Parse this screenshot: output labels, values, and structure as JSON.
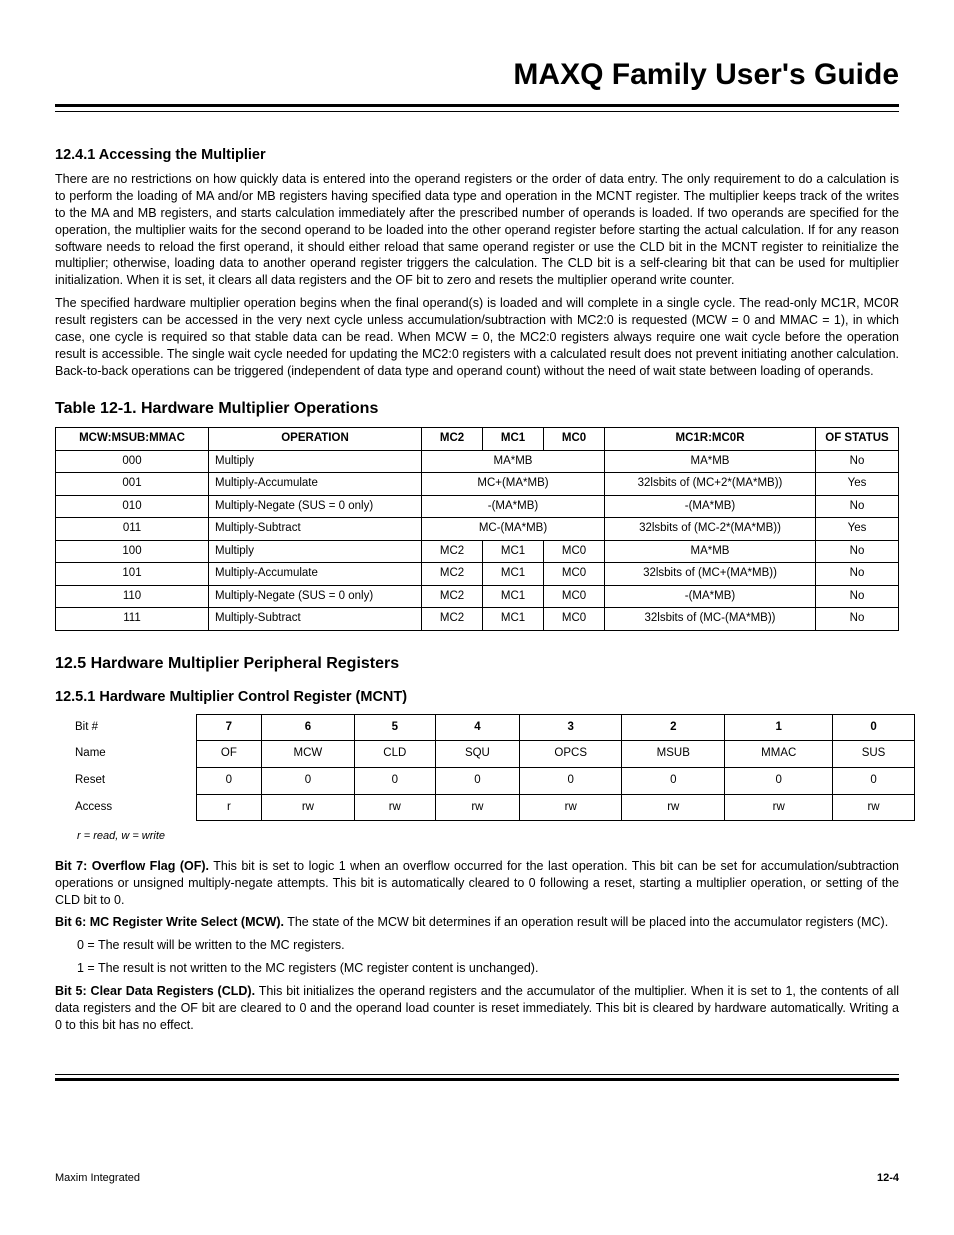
{
  "header": {
    "title": "MAXQ Family User's Guide"
  },
  "sections": {
    "s1241_h": "12.4.1 Accessing the Multiplier",
    "s1241_p1": "There are no restrictions on how quickly data is entered into the operand registers or the order of data entry. The only requirement to do a calculation is to perform the loading of MA and/or MB registers having specified data type and operation in the MCNT register. The multiplier keeps track of the writes to the MA and MB registers, and starts calculation immediately after the prescribed number of operands is loaded. If two operands are specified for the operation, the multiplier waits for the second operand to be loaded into the other operand register before starting the actual calculation. If for any reason software needs to reload the first operand, it should either reload that same operand register or use the CLD bit in the MCNT register to reinitialize the multiplier; otherwise, loading data to another operand register triggers the calculation. The CLD bit is a self-clearing bit that can be used for multiplier initialization. When it is set, it clears all data registers and the OF bit to zero and resets the multiplier operand write counter.",
    "s1241_p2": "The specified hardware multiplier operation begins when the final operand(s) is loaded and will complete in a single cycle. The read-only MC1R, MC0R result registers can be accessed in the very next cycle unless accumulation/subtraction with MC2:0 is requested (MCW = 0 and MMAC = 1), in which case, one cycle is required so that stable data can be read. When MCW = 0, the MC2:0 registers always require one wait cycle before the operation result is accessible. The single wait cycle needed for updating the MC2:0 registers with a calculated result does not prevent initiating another calculation. Back-to-back operations can be triggered (independent of data type and operand count) without the need of wait state between loading of operands.",
    "t121_cap": "Table 12-1. Hardware Multiplier Operations",
    "s125_h": "12.5 Hardware Multiplier Peripheral Registers",
    "s1251_h": "12.5.1 Hardware Multiplier Control Register (MCNT)",
    "rwnote": "r = read, w = write",
    "bit7_l": "Bit 7: Overflow Flag (OF).",
    "bit7_t": " This bit is set to logic 1 when an overflow occurred for the last operation. This bit can be set for accumulation/subtraction operations or unsigned multiply-negate attempts. This bit is automatically cleared to 0 following a reset, starting a multiplier operation, or setting of the CLD bit to 0.",
    "bit6_l": "Bit 6: MC Register Write Select (MCW).",
    "bit6_t": " The state of the MCW bit determines if an operation result will be placed into the accumulator registers (MC).",
    "bit6_0": "0 = The result will be written to the MC registers.",
    "bit6_1": "1 = The result is not written to the MC registers (MC register content is unchanged).",
    "bit5_l": "Bit 5: Clear Data Registers (CLD).",
    "bit5_t": " This bit initializes the operand registers and the accumulator of the multiplier. When it is set to 1, the contents of all data registers and the OF bit are cleared to 0 and the operand load counter is reset immediately. This bit is cleared by hardware automatically. Writing a 0 to this bit has no effect."
  },
  "table121": {
    "headers": [
      "MCW:MSUB:MMAC",
      "OPERATION",
      "MC2",
      "MC1",
      "MC0",
      "MC1R:MC0R",
      "OF STATUS"
    ],
    "rows": [
      {
        "code": "000",
        "op": "Multiply",
        "merged": true,
        "merged_text": "MA*MB",
        "mc1r": "MA*MB",
        "of": "No"
      },
      {
        "code": "001",
        "op": "Multiply-Accumulate",
        "merged": true,
        "merged_text": "MC+(MA*MB)",
        "mc1r": "32lsbits of (MC+2*(MA*MB))",
        "of": "Yes"
      },
      {
        "code": "010",
        "op": "Multiply-Negate (SUS = 0 only)",
        "merged": true,
        "merged_text": "-(MA*MB)",
        "mc1r": "-(MA*MB)",
        "of": "No"
      },
      {
        "code": "011",
        "op": "Multiply-Subtract",
        "merged": true,
        "merged_text": "MC-(MA*MB)",
        "mc1r": "32lsbits of (MC-2*(MA*MB))",
        "of": "Yes"
      },
      {
        "code": "100",
        "op": "Multiply",
        "mc2": "MC2",
        "mc1": "MC1",
        "mc0": "MC0",
        "mc1r": "MA*MB",
        "of": "No"
      },
      {
        "code": "101",
        "op": "Multiply-Accumulate",
        "mc2": "MC2",
        "mc1": "MC1",
        "mc0": "MC0",
        "mc1r": "32lsbits of (MC+(MA*MB))",
        "of": "No"
      },
      {
        "code": "110",
        "op": "Multiply-Negate (SUS = 0 only)",
        "mc2": "MC2",
        "mc1": "MC1",
        "mc0": "MC0",
        "mc1r": "-(MA*MB)",
        "of": "No"
      },
      {
        "code": "111",
        "op": "Multiply-Subtract",
        "mc2": "MC2",
        "mc1": "MC1",
        "mc0": "MC0",
        "mc1r": "32lsbits of (MC-(MA*MB))",
        "of": "No"
      }
    ]
  },
  "regtable": {
    "rowlabels": [
      "Bit #",
      "Name",
      "Reset",
      "Access"
    ],
    "bits": [
      "7",
      "6",
      "5",
      "4",
      "3",
      "2",
      "1",
      "0"
    ],
    "names": [
      "OF",
      "MCW",
      "CLD",
      "SQU",
      "OPCS",
      "MSUB",
      "MMAC",
      "SUS"
    ],
    "resets": [
      "0",
      "0",
      "0",
      "0",
      "0",
      "0",
      "0",
      "0"
    ],
    "access": [
      "r",
      "rw",
      "rw",
      "rw",
      "rw",
      "rw",
      "rw",
      "rw"
    ]
  },
  "footer": {
    "left": "Maxim Integrated",
    "right": "12-4"
  }
}
